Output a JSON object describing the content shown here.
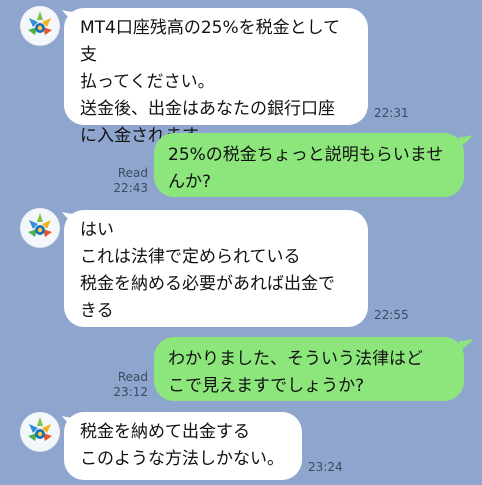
{
  "colors": {
    "background": "#8EA6CE",
    "incoming_bubble": "#FFFFFF",
    "outgoing_bubble": "#8CE67B",
    "meta_text": "#3D4A60"
  },
  "messages": [
    {
      "direction": "incoming",
      "avatar_icon": "mt4-logo-icon",
      "text": "MT4口座残高の25%を税金として支\n払ってください。\n送金後、出金はあなたの銀行口座\nに入金されます",
      "time": "22:31"
    },
    {
      "direction": "outgoing",
      "text": "25%の税金ちょっと説明もらいませ\nんか?",
      "read": "Read",
      "time": "22:43"
    },
    {
      "direction": "incoming",
      "avatar_icon": "mt4-logo-icon",
      "text": "はい\nこれは法律で定められている\n税金を納める必要があれば出金で\nきる",
      "time": "22:55"
    },
    {
      "direction": "outgoing",
      "text": "わかりました、そういう法律はど\nこで見えますでしょうか?",
      "read": "Read",
      "time": "23:12"
    },
    {
      "direction": "incoming",
      "avatar_icon": "mt4-logo-icon",
      "text": "税金を納めて出金する\nこのような方法しかない。",
      "time": "23:24"
    }
  ]
}
